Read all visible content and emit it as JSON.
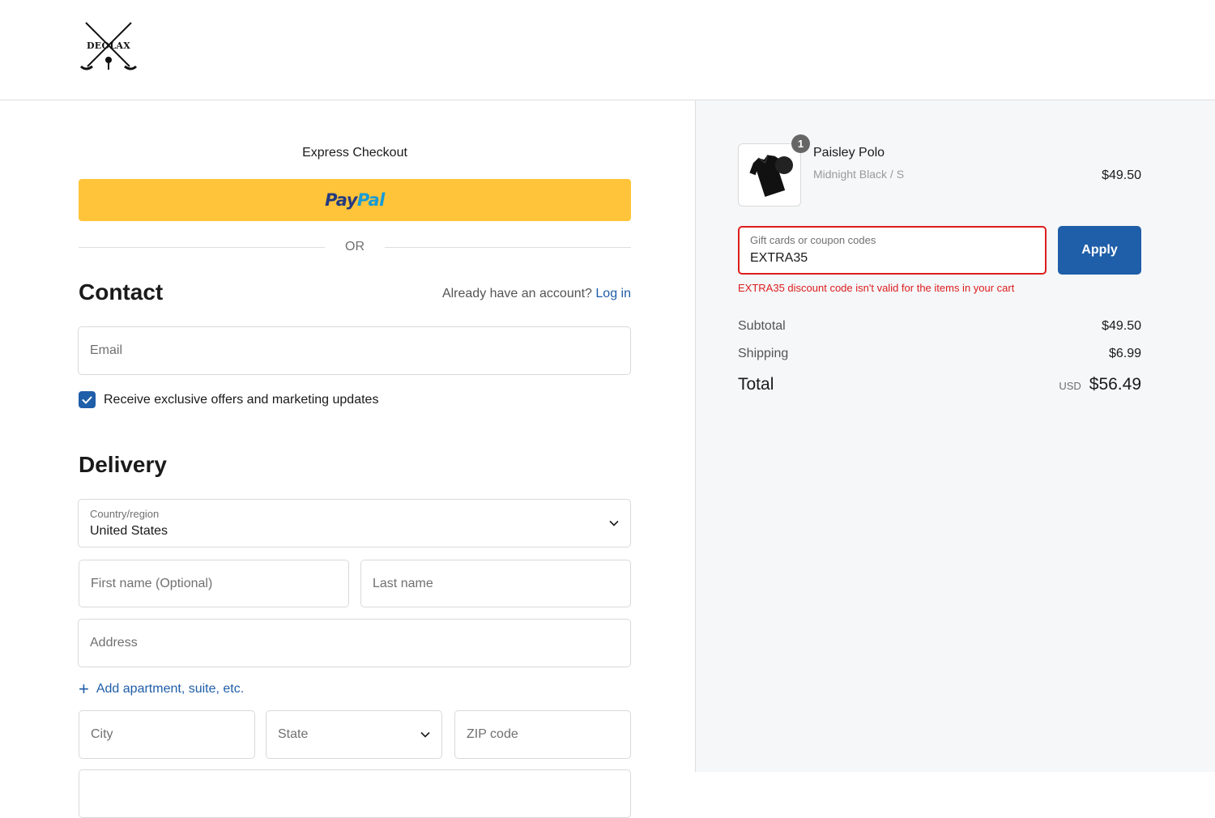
{
  "brand": {
    "logo_text": "DEOLAX"
  },
  "express": {
    "title": "Express Checkout",
    "paypal_pay": "Pay",
    "paypal_pal": "Pal",
    "or_text": "OR"
  },
  "contact": {
    "title": "Contact",
    "account_prompt": "Already have an account?",
    "login_link": "Log in",
    "email_placeholder": "Email",
    "marketing_label": "Receive exclusive offers and marketing updates",
    "marketing_checked": true
  },
  "delivery": {
    "title": "Delivery",
    "country_label": "Country/region",
    "country_value": "United States",
    "first_name_placeholder": "First name (Optional)",
    "last_name_placeholder": "Last name",
    "address_placeholder": "Address",
    "add_apartment": "Add apartment, suite, etc.",
    "city_placeholder": "City",
    "state_placeholder": "State",
    "zip_placeholder": "ZIP code"
  },
  "order": {
    "item": {
      "quantity": "1",
      "name": "Paisley Polo",
      "variant": "Midnight Black / S",
      "price": "$49.50"
    },
    "coupon": {
      "label": "Gift cards or coupon codes",
      "value": "EXTRA35",
      "apply_label": "Apply",
      "error": "EXTRA35 discount code isn't valid for the items in your cart"
    },
    "subtotal_label": "Subtotal",
    "subtotal_value": "$49.50",
    "shipping_label": "Shipping",
    "shipping_value": "$6.99",
    "total_label": "Total",
    "currency": "USD",
    "total_value": "$56.49"
  },
  "colors": {
    "accent": "#1f5ea8",
    "paypal_yellow": "#ffc439",
    "error": "#dd1d1d"
  }
}
